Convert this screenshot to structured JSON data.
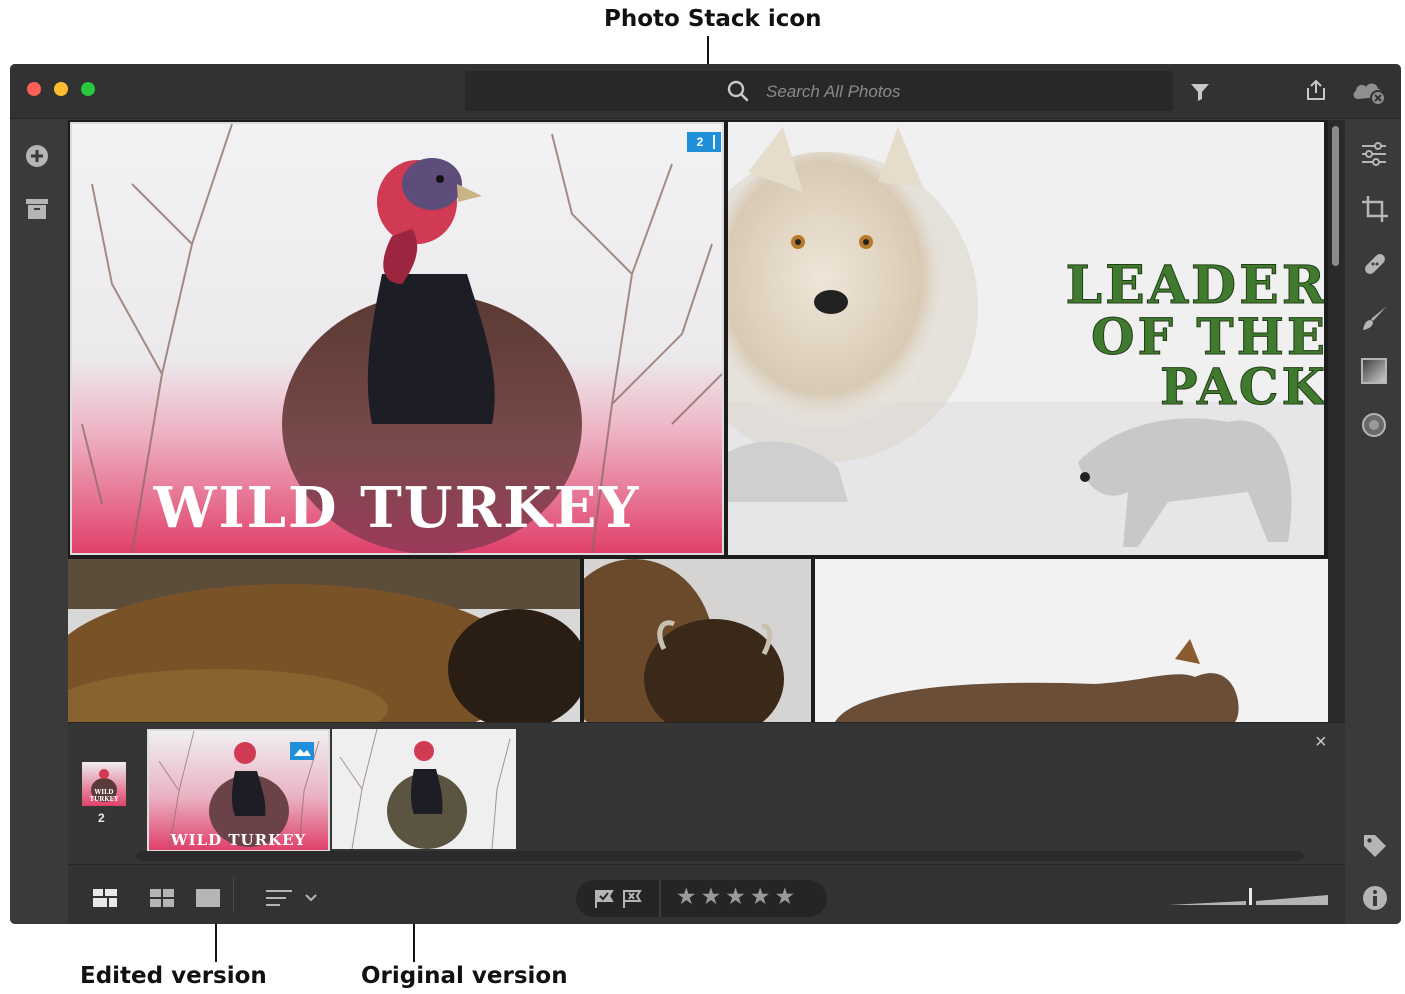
{
  "callouts": {
    "stack_icon": "Photo Stack icon",
    "edited": "Edited version",
    "original": "Original version"
  },
  "search": {
    "placeholder": "Search All Photos"
  },
  "grid": {
    "stack_count": "2",
    "turkey_title": "WILD TURKEY",
    "wolf_title_lines": [
      "LEADER",
      "OF THE",
      "PACK"
    ]
  },
  "filmstrip": {
    "stack_count": "2",
    "stack_thumb_label": "WILD TURKEY",
    "edited_label": "WILD TURKEY",
    "close_glyph": "×"
  },
  "toolbar": {
    "stars": "★★★★★"
  },
  "colors": {
    "window_bg": "#3b3b3b",
    "accent_blue": "#1e8fd8",
    "turkey_pink": "#e0406a",
    "wolf_text_green": "#3f7a2e"
  },
  "icons": [
    "search-icon",
    "filter-icon",
    "share-icon",
    "cloud-sync-icon",
    "add-icon",
    "archive-icon",
    "edit-sliders-icon",
    "crop-icon",
    "healing-icon",
    "brush-icon",
    "gradient-icon",
    "radial-icon",
    "tag-icon",
    "info-icon",
    "square-grid-icon",
    "photo-grid-icon",
    "detail-view-icon",
    "sort-icon",
    "flag-pick-icon",
    "flag-reject-icon"
  ]
}
